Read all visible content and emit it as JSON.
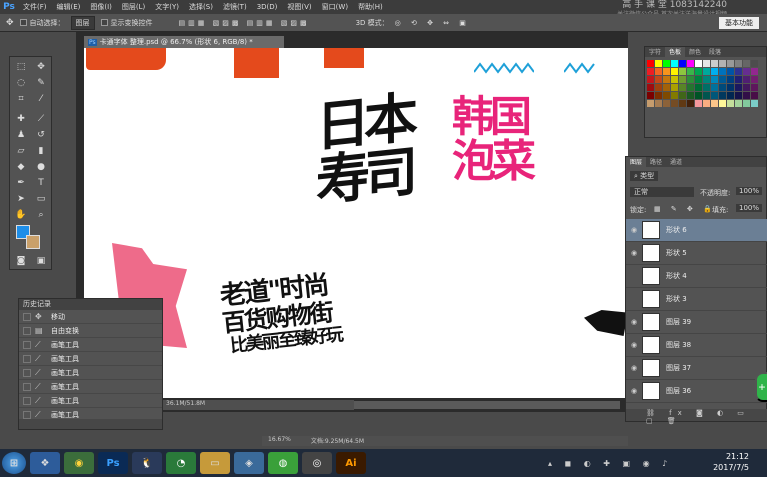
{
  "menubar": {
    "logo": "Ps",
    "items": [
      "文件(F)",
      "编辑(E)",
      "图像(I)",
      "图层(L)",
      "文字(Y)",
      "选择(S)",
      "滤镜(T)",
      "3D(D)",
      "视图(V)",
      "窗口(W)",
      "帮助(H)"
    ]
  },
  "watermark": {
    "line1": "高 手 课 堂  1083142240",
    "line2": "关注微信公众号  首次关注送海量设计视频"
  },
  "options": {
    "auto_select": "自动选择：",
    "auto_select_value": "图层",
    "show_transform": "显示变换控件",
    "mode3d": "3D 模式：",
    "workspace": "基本功能"
  },
  "document": {
    "tab_title": "卡通字体 整理.psd @ 66.7% (形状 6, RGB/8) *",
    "status_left": "36.1M/51.8M",
    "status_zoom": "16.67%",
    "status_doc": "文档:9.25M/64.5M"
  },
  "art": {
    "japan": [
      "日本",
      "寿司"
    ],
    "korea": [
      "韩国",
      "泡菜"
    ],
    "bottom": [
      "老道\"时尚",
      "百货购物街",
      "比美丽至臻好玩"
    ]
  },
  "history": {
    "title": "历史记录",
    "rows": [
      {
        "label": "移动",
        "icon": "move-icon"
      },
      {
        "label": "自由变换",
        "icon": "transform-icon"
      },
      {
        "label": "画笔工具",
        "icon": "brush-icon"
      },
      {
        "label": "画笔工具",
        "icon": "brush-icon"
      },
      {
        "label": "画笔工具",
        "icon": "brush-icon"
      },
      {
        "label": "画笔工具",
        "icon": "brush-icon"
      },
      {
        "label": "画笔工具",
        "icon": "brush-icon"
      },
      {
        "label": "画笔工具",
        "icon": "brush-icon"
      }
    ]
  },
  "swatches": {
    "tabs": [
      "字符",
      "色板",
      "颜色",
      "段落"
    ]
  },
  "layers": {
    "tabs": [
      "图层",
      "路径",
      "通道"
    ],
    "kind": "类型",
    "blend": "正常",
    "opacity_label": "不透明度:",
    "opacity": "100%",
    "lock_label": "锁定:",
    "fill_label": "填充:",
    "fill": "100%",
    "rows": [
      {
        "name": "形状 6",
        "selected": true
      },
      {
        "name": "形状 5",
        "selected": false
      },
      {
        "name": "形状 4",
        "selected": false
      },
      {
        "name": "形状 3",
        "selected": false
      },
      {
        "name": "图层 39",
        "selected": false
      },
      {
        "name": "图层 38",
        "selected": false
      },
      {
        "name": "图层 37",
        "selected": false
      },
      {
        "name": "图层 36",
        "selected": false
      }
    ]
  },
  "taskbar": {
    "icons": [
      "start",
      "app1",
      "app2",
      "Ps",
      "QQ",
      "browser",
      "folder",
      "app3",
      "wechat",
      "app4",
      "Ai"
    ],
    "time": "21:12",
    "date": "2017/7/5"
  }
}
